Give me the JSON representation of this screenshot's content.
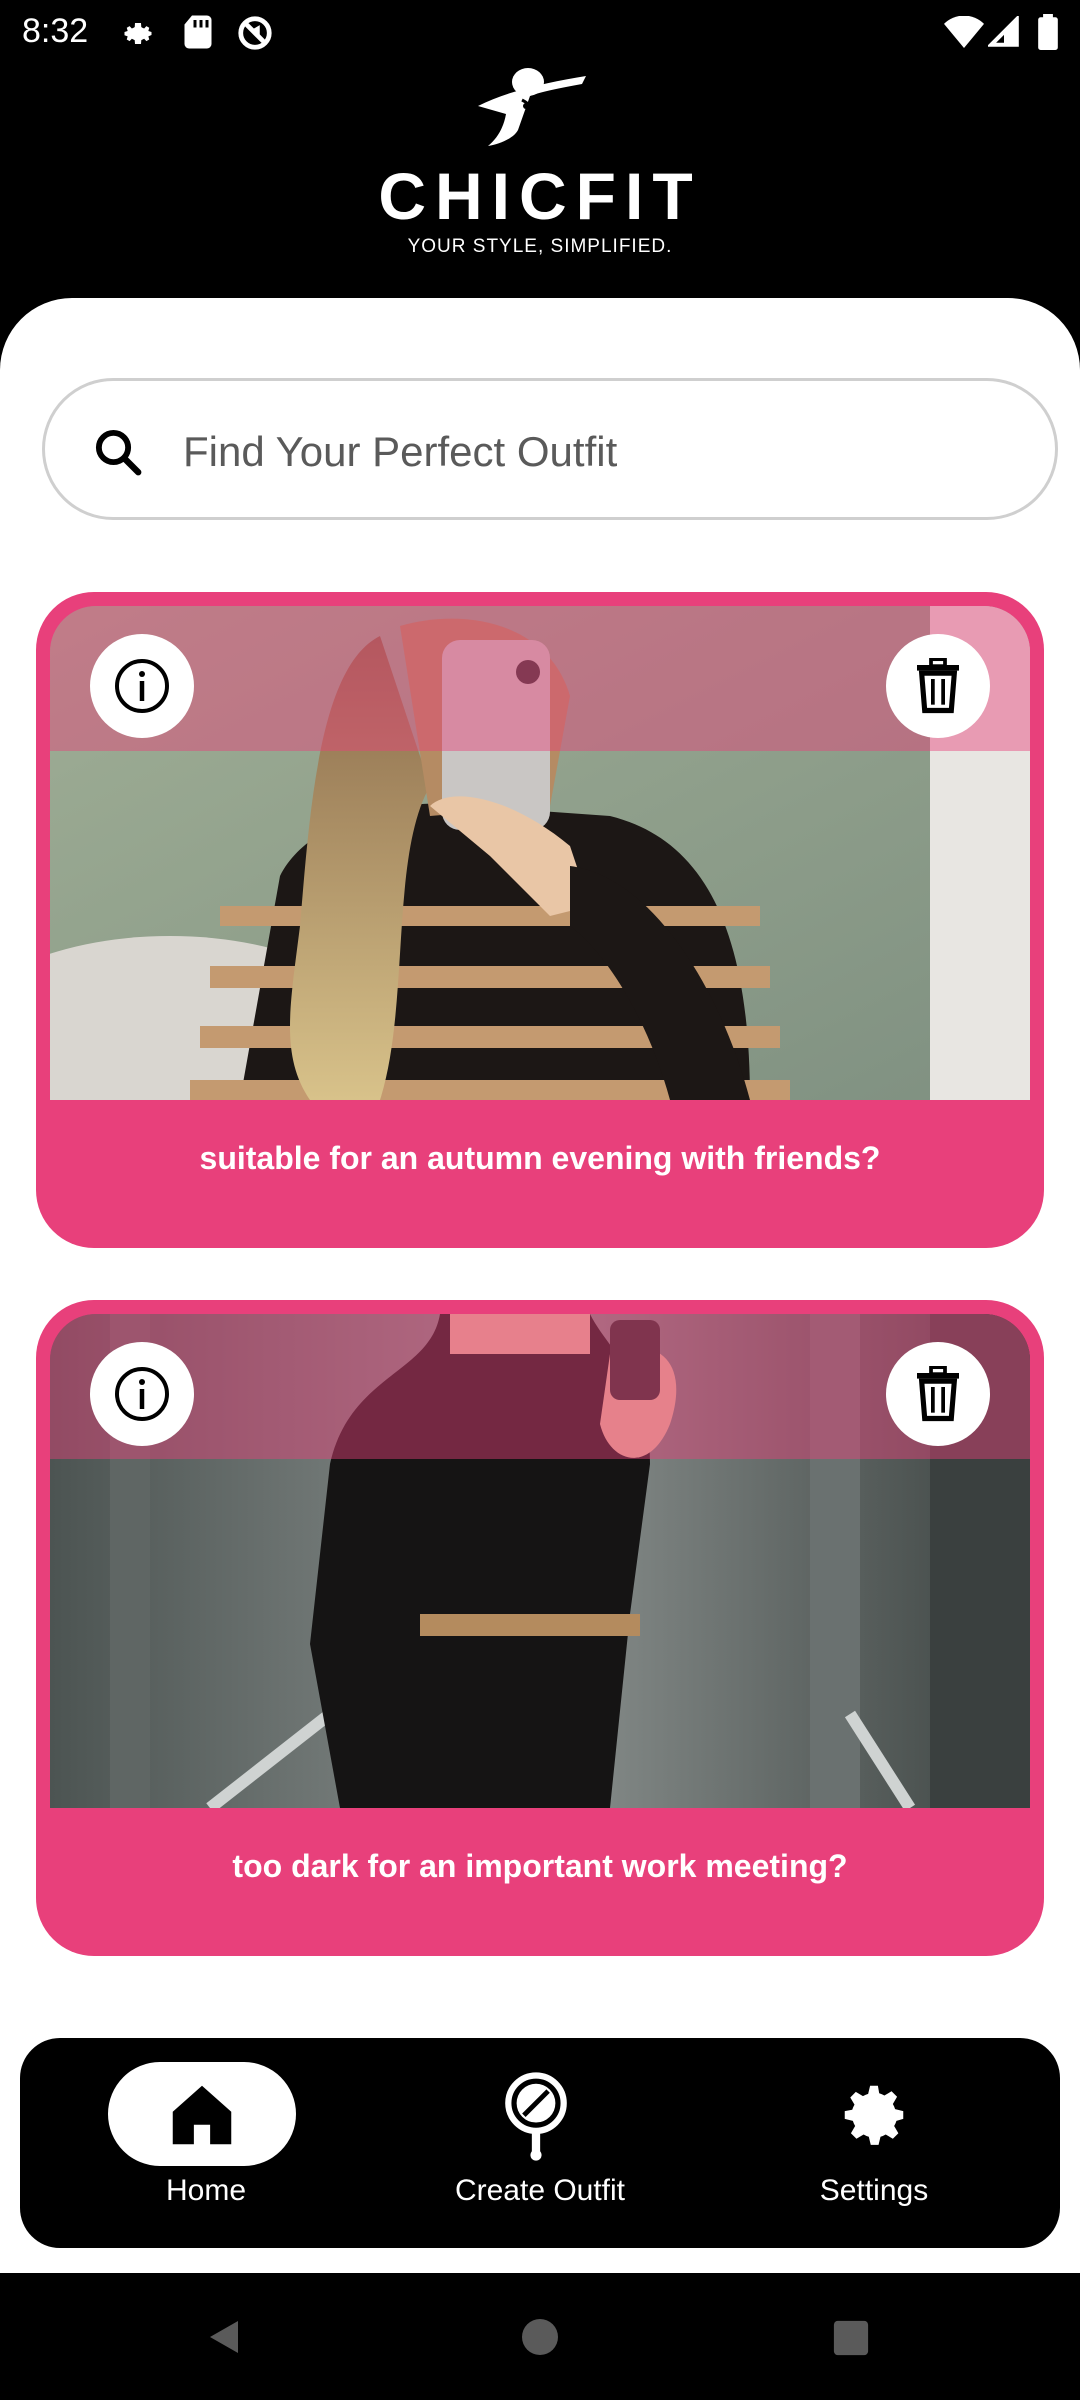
{
  "status_bar": {
    "time": "8:32",
    "icons_left": [
      "gear-icon",
      "sd-card-icon",
      "no-sync-icon"
    ],
    "icons_right": [
      "wifi-icon",
      "cell-signal-icon",
      "battery-icon"
    ]
  },
  "header": {
    "brand": "CHICFIT",
    "tagline": "YOUR STYLE, SIMPLIFIED."
  },
  "search": {
    "placeholder": "Find Your Perfect Outfit"
  },
  "cards": [
    {
      "caption": "suitable for an autumn evening with friends?"
    },
    {
      "caption": "too dark for an important work meeting?"
    }
  ],
  "bottom_nav": {
    "items": [
      {
        "label": "Home",
        "icon": "home-icon",
        "active": true
      },
      {
        "label": "Create Outfit",
        "icon": "mirror-icon",
        "active": false
      },
      {
        "label": "Settings",
        "icon": "gear-icon",
        "active": false
      }
    ]
  },
  "colors": {
    "accent": "#e8407b",
    "background": "#000000",
    "surface": "#ffffff"
  }
}
